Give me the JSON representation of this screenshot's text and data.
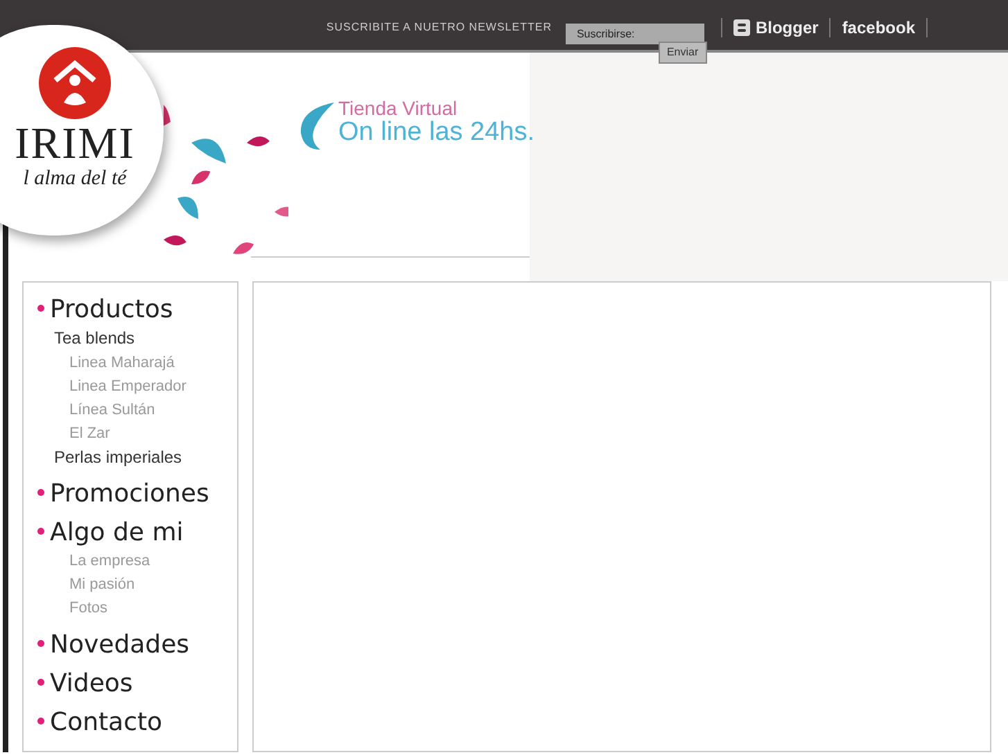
{
  "top_bar": {
    "newsletter_label": "SUSCRIBITE A NUETRO NEWSLETTER",
    "newsletter_field": {
      "value": "Suscribirse:"
    },
    "submit_button": "Enviar",
    "links": [
      "Blogger",
      "facebook"
    ]
  },
  "logo": {
    "name": "IRIMI",
    "tagline": "l alma del té"
  },
  "banner": {
    "line_1": "Tienda Virtual",
    "line_2": "On line las 24hs."
  },
  "menu": [
    {
      "label": "Productos",
      "children": [
        {
          "label": "Tea blends",
          "kind": "heading",
          "children": [
            {
              "label": "Linea Maharajá"
            },
            {
              "label": "Linea Emperador"
            },
            {
              "label": "Línea Sultán"
            },
            {
              "label": "El Zar"
            }
          ]
        },
        {
          "label": "Perlas imperiales",
          "kind": "heading"
        }
      ]
    },
    {
      "label": "Promociones"
    },
    {
      "label": "Algo de mi",
      "children": [
        {
          "label": "La empresa",
          "kind": "link"
        },
        {
          "label": "Mi pasión",
          "kind": "link"
        },
        {
          "label": "Fotos",
          "kind": "link"
        }
      ]
    },
    {
      "label": "Novedades"
    },
    {
      "label": "Videos"
    },
    {
      "label": "Contacto"
    }
  ]
}
